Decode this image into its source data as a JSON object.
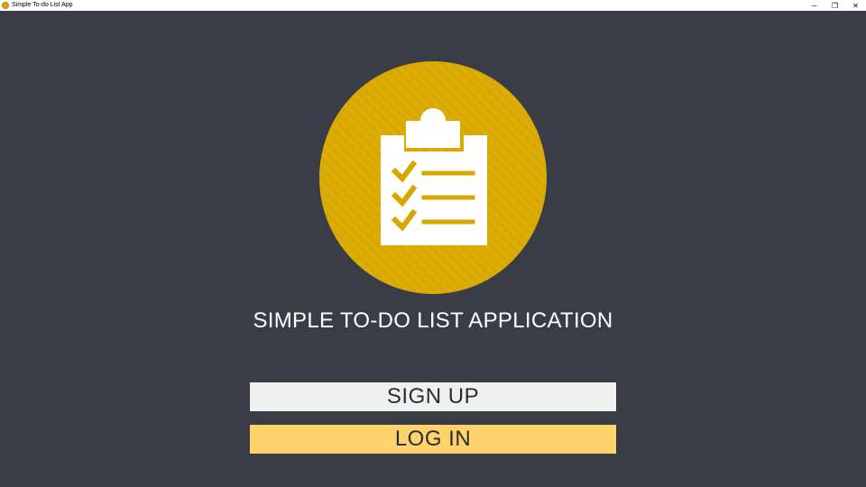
{
  "window": {
    "title": "Simple To-do List App",
    "controls": {
      "minimize": "─",
      "restore": "❐",
      "close": "✕"
    }
  },
  "logo": {
    "icon": "clipboard-checklist-icon",
    "circle_color": "#d9a800",
    "glyph_color": "#ffffff"
  },
  "main": {
    "title": "SIMPLE TO-DO LIST APPLICATION",
    "signup_label": "SIGN UP",
    "login_label": "LOG IN"
  },
  "colors": {
    "background": "#3a3d45",
    "signup_bg": "#f0f0f0",
    "login_bg": "#ffd36b",
    "button_text": "#2b2d33"
  }
}
